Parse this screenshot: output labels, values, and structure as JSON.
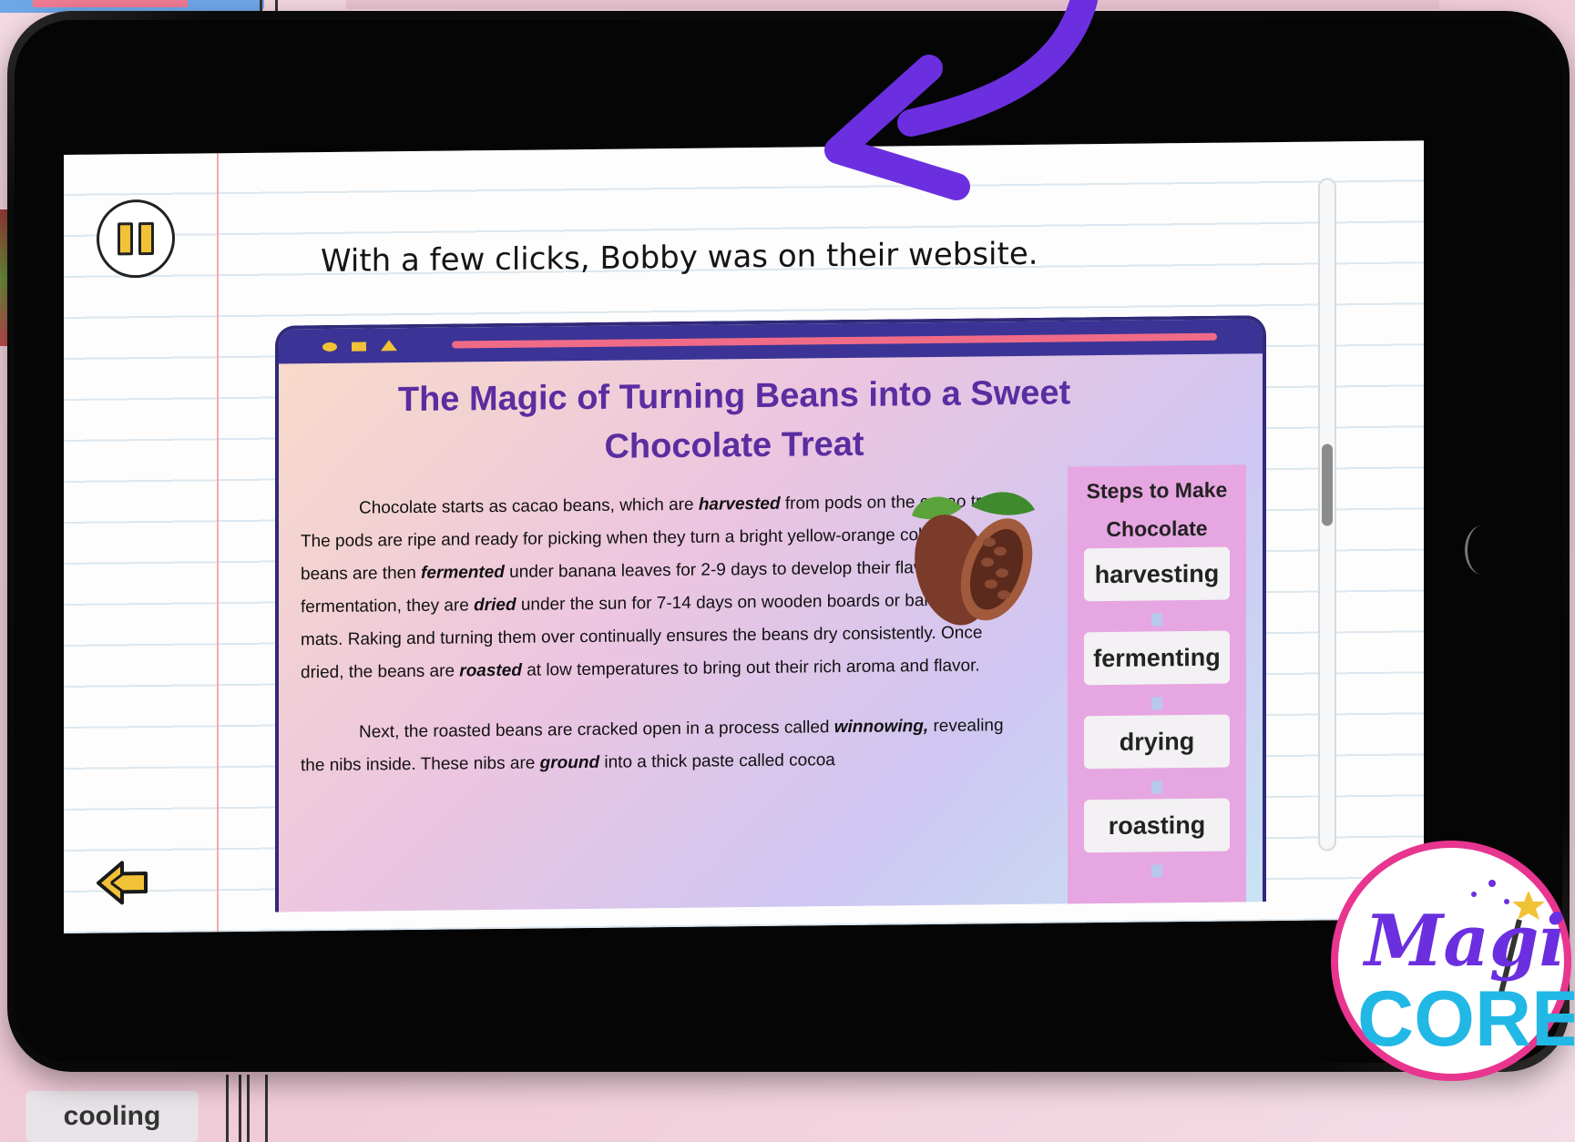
{
  "narration": {
    "text": "With a few clicks, Bobby was on their website."
  },
  "website": {
    "title": "The Magic of Turning Beans into a Sweet Chocolate Treat",
    "paragraph_1": [
      "Chocolate starts as cacao beans, which are ",
      "harvested",
      " from pods on the cacao tree. The pods are ripe and ready for picking when they turn a bright yellow-orange color. The beans are then ",
      "fermented",
      " under banana leaves for 2-9 days to develop their flavor. After fermentation, they are ",
      "dried",
      " under the sun for 7-14 days on wooden boards or bamboo mats. Raking and turning them over continually ensures the beans dry consistently. Once dried, the beans are ",
      "roasted",
      " at low temperatures to bring out their rich aroma and flavor."
    ],
    "paragraph_2": [
      "Next, the roasted beans are cracked open in a process called ",
      "winnowing,",
      " revealing the nibs inside. These nibs are ",
      "ground",
      " into a thick paste called cocoa"
    ],
    "steps_title": "Steps to Make Chocolate",
    "steps": [
      "harvesting",
      "fermenting",
      "drying",
      "roasting"
    ]
  },
  "controls": {
    "pause_icon": "pause-icon",
    "back_icon": "back-arrow-icon"
  },
  "background": {
    "chip_label": "cooling"
  },
  "logo": {
    "line1": "Magi",
    "line2": "CORE"
  },
  "colors": {
    "accent_purple": "#6b2fe0",
    "title_purple": "#5a2da0",
    "browser_bar": "#3b3496",
    "pause_yellow": "#f2c236",
    "steps_pink": "#e6a6e1"
  }
}
